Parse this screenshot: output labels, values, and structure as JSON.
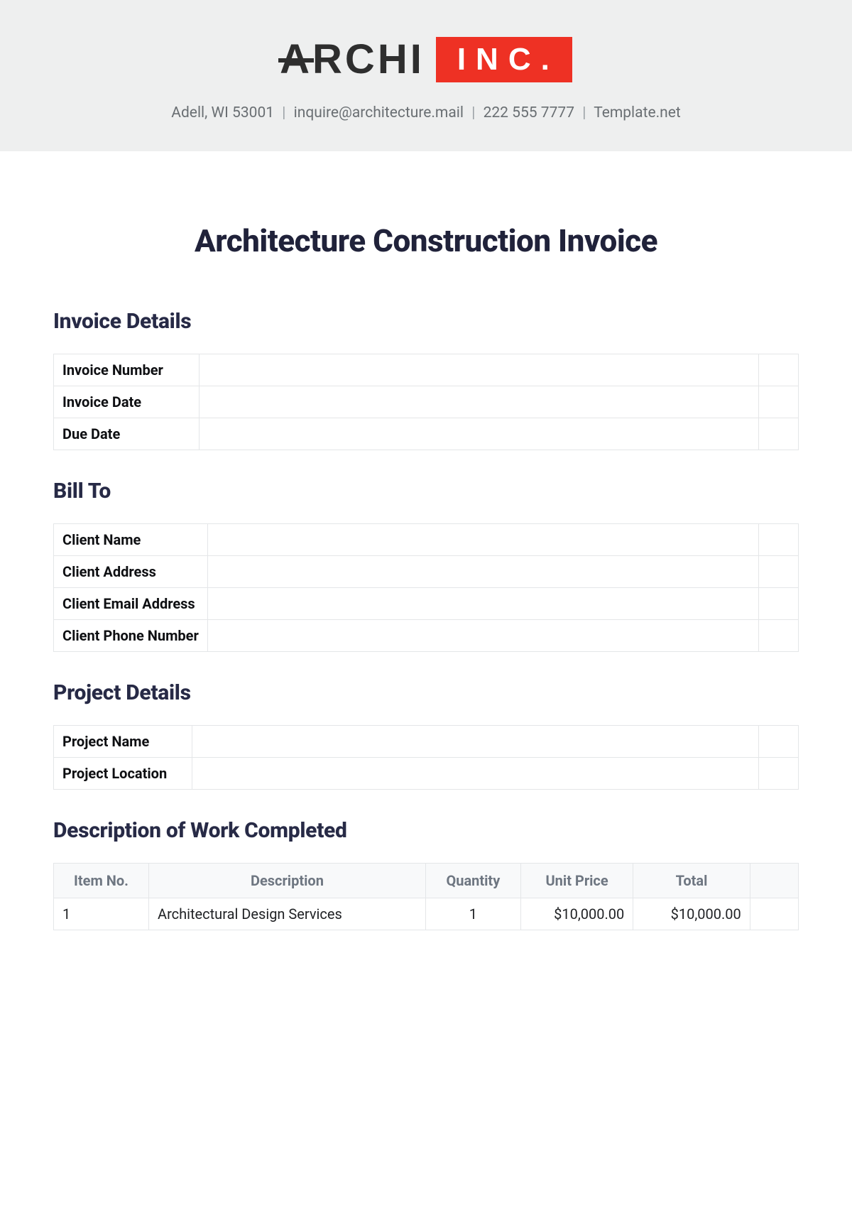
{
  "banner": {
    "logo_text": "ARCHI",
    "logo_badge": "INC.",
    "address": "Adell, WI 53001",
    "email": "inquire@architecture.mail",
    "phone": "222 555 7777",
    "site": "Template.net"
  },
  "title": "Architecture Construction Invoice",
  "sections": {
    "invoice_details": {
      "heading": "Invoice Details",
      "rows": [
        {
          "label": "Invoice Number",
          "value": ""
        },
        {
          "label": "Invoice Date",
          "value": ""
        },
        {
          "label": "Due Date",
          "value": ""
        }
      ]
    },
    "bill_to": {
      "heading": "Bill To",
      "rows": [
        {
          "label": "Client Name",
          "value": ""
        },
        {
          "label": "Client Address",
          "value": ""
        },
        {
          "label": "Client Email Address",
          "value": ""
        },
        {
          "label": "Client Phone Number",
          "value": ""
        }
      ]
    },
    "project_details": {
      "heading": "Project Details",
      "rows": [
        {
          "label": "Project Name",
          "value": ""
        },
        {
          "label": "Project Location",
          "value": ""
        }
      ]
    },
    "work": {
      "heading": "Description of Work Completed",
      "columns": {
        "itemno": "Item No.",
        "desc": "Description",
        "qty": "Quantity",
        "unit": "Unit Price",
        "total": "Total"
      },
      "rows": [
        {
          "itemno": "1",
          "desc": "Architectural Design Services",
          "qty": "1",
          "unit": "$10,000.00",
          "total": "$10,000.00"
        }
      ]
    }
  }
}
